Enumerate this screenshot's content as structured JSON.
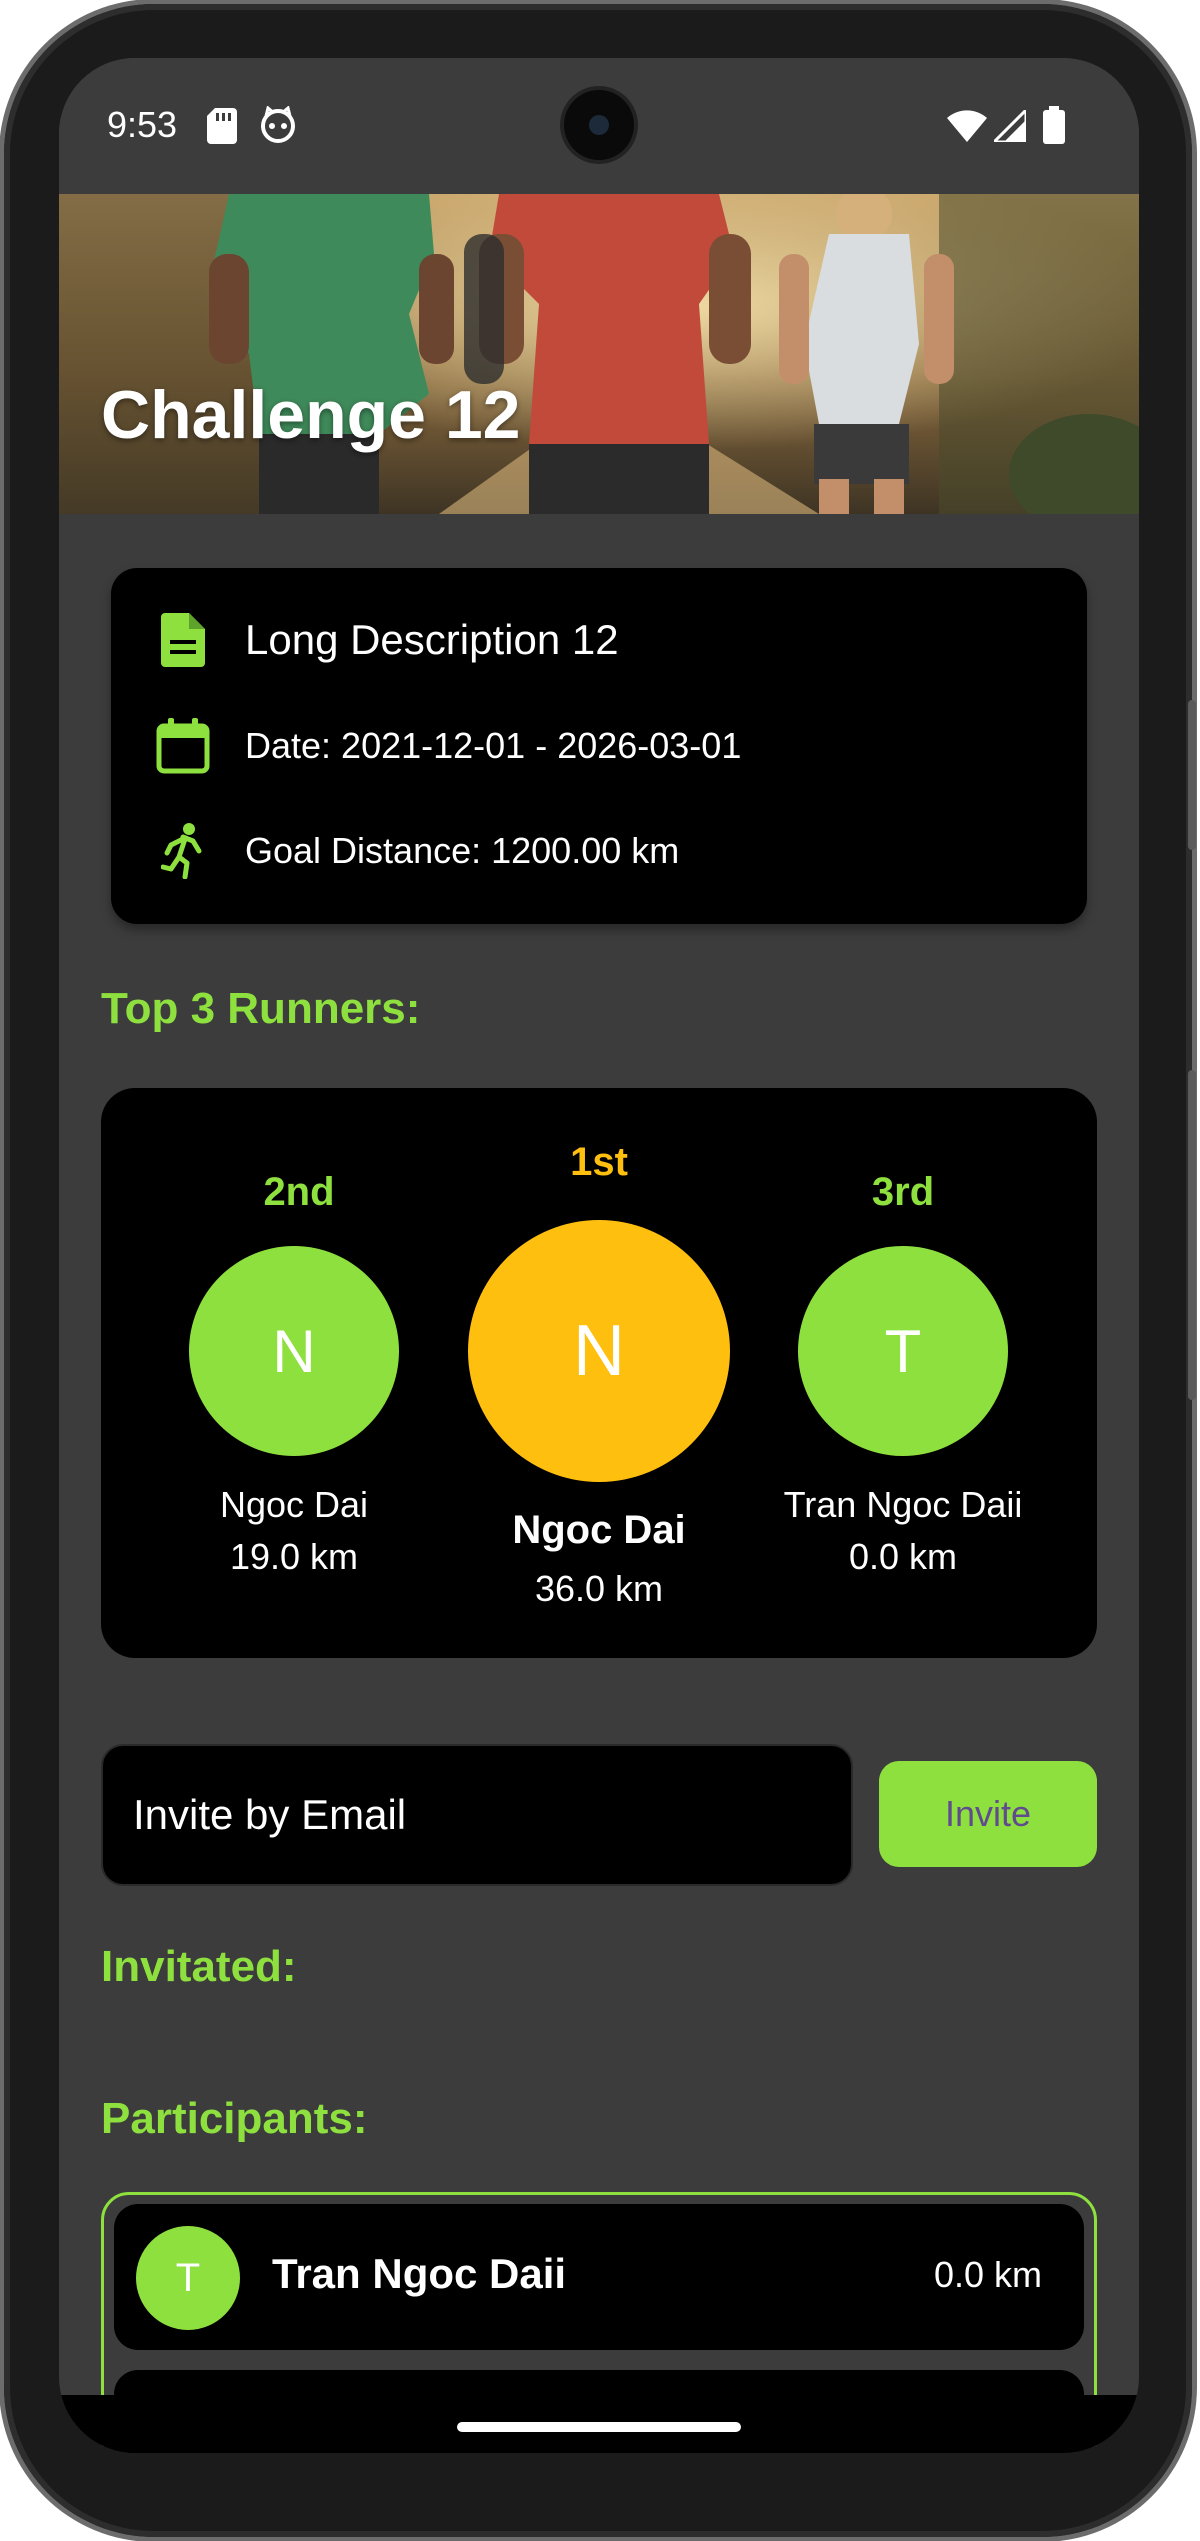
{
  "status_bar": {
    "time": "9:53",
    "left_icons": [
      "sd-card-icon",
      "cat-icon"
    ],
    "right_icons": [
      "wifi-icon",
      "signal-icon",
      "battery-icon"
    ]
  },
  "challenge": {
    "title": "Challenge 12",
    "description": "Long Description 12",
    "date": "Date: 2021-12-01 - 2026-03-01",
    "goal": "Goal Distance: 1200.00 km"
  },
  "top_runners": {
    "title": "Top 3 Runners:",
    "first": {
      "rank": "1st",
      "initial": "N",
      "name": "Ngoc Dai",
      "distance": "36.0 km"
    },
    "second": {
      "rank": "2nd",
      "initial": "N",
      "name": "Ngoc Dai",
      "distance": "19.0 km"
    },
    "third": {
      "rank": "3rd",
      "initial": "T",
      "name": "Tran Ngoc Daii",
      "distance": "0.0 km"
    }
  },
  "invite": {
    "placeholder": "Invite by Email",
    "button_label": "Invite"
  },
  "invited": {
    "title": "Invitated:"
  },
  "participants": {
    "title": "Participants:",
    "items": [
      {
        "initial": "T",
        "name": "Tran Ngoc Daii",
        "distance": "0.0 km"
      },
      {
        "initial": "",
        "name": "",
        "distance": ""
      }
    ]
  },
  "colors": {
    "accent_green": "#8ee03f",
    "gold": "#ffbf0f",
    "card_bg": "#000000",
    "screen_bg": "#3c3c3c",
    "button_text": "#5f4b8e"
  }
}
